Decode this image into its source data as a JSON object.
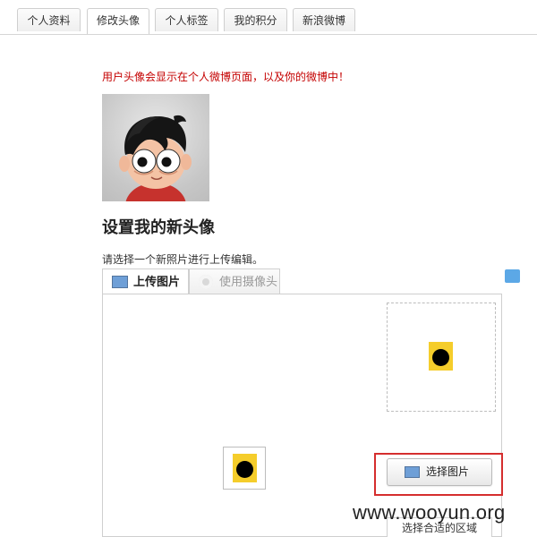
{
  "tabs": [
    {
      "label": "个人资料"
    },
    {
      "label": "修改头像"
    },
    {
      "label": "个人标签"
    },
    {
      "label": "我的积分"
    },
    {
      "label": "新浪微博"
    }
  ],
  "notice": "用户头像会显示在个人微博页面，以及你的微博中！",
  "heading": "设置我的新头像",
  "instruction": "请选择一个新照片进行上传编辑。",
  "upload_tabs": [
    {
      "label": "上传图片",
      "icon": "upload-image-icon"
    },
    {
      "label": "使用摄像头",
      "icon": "camera-icon"
    }
  ],
  "actions": {
    "choose_image": "选择图片",
    "select_area": "选择合适的区域"
  },
  "watermark": "www.wooyun.org",
  "colors": {
    "accent_red": "#d52e2e",
    "notice_red": "#c40000",
    "preview_yellow": "#f5cd2b"
  }
}
